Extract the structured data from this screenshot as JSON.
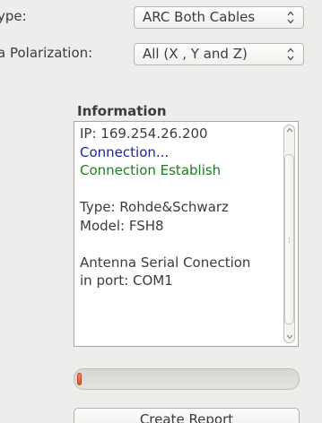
{
  "form": {
    "type_label": "ype:",
    "type_value": "ARC Both Cables",
    "polarization_label": "a Polarization:",
    "polarization_value": "All (X , Y and Z)"
  },
  "information": {
    "title": "Information",
    "lines": [
      {
        "text": "IP: 169.254.26.200",
        "color": "#3c3c3c"
      },
      {
        "text": "Connection...",
        "color": "#1f1f9e"
      },
      {
        "text": "Connection Establish",
        "color": "#1e7d1e"
      },
      {
        "text": "",
        "color": "#3c3c3c"
      },
      {
        "text": "Type: Rohde&Schwarz",
        "color": "#3c3c3c"
      },
      {
        "text": "Model: FSH8",
        "color": "#3c3c3c"
      },
      {
        "text": "",
        "color": "#3c3c3c"
      },
      {
        "text": "Antenna Serial Conection",
        "color": "#3c3c3c"
      },
      {
        "text": "in port: COM1",
        "color": "#3c3c3c"
      }
    ]
  },
  "progress": {
    "fraction": 0.02,
    "color": "#d9522c"
  },
  "actions": {
    "create_report_label": "Create Report"
  },
  "icons": {
    "combo_arrows": "up-down-chevron-icon",
    "scroll_up": "scroll-up-arrow-icon",
    "scroll_down": "scroll-down-arrow-icon"
  }
}
